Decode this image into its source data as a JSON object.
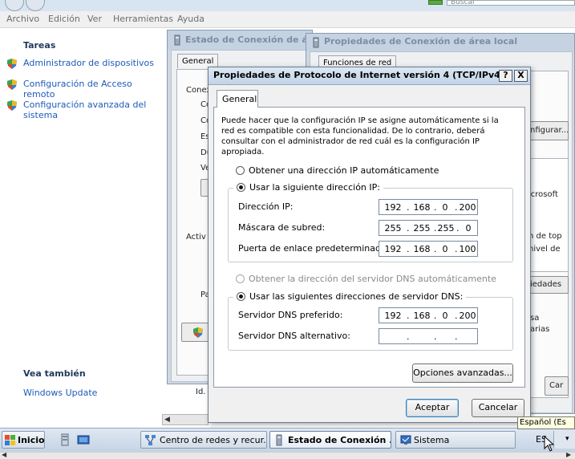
{
  "top": {
    "search_placeholder": "Buscar"
  },
  "menubar": {
    "items": [
      "Archivo",
      "Edición",
      "Ver",
      "Herramientas",
      "Ayuda"
    ]
  },
  "sidebar": {
    "tasks_heading": "Tareas",
    "tasks": [
      "Administrador de dispositivos",
      "Configuración de Acceso remoto",
      "Configuración avanzada del sistema"
    ],
    "see_also_heading": "Vea también",
    "see_also_link": "Windows Update"
  },
  "back_window_1": {
    "title": "Estado de Conexión de área local",
    "tab": "General",
    "fragments": [
      "Conex",
      "Co",
      "Co",
      "Est",
      "Du",
      "Vel",
      "Activ",
      "Pa"
    ],
    "bottom_fragment": "Id."
  },
  "back_window_2": {
    "title": "Propiedades de Conexión de área local",
    "tab": "Funciones de red",
    "fragments": [
      "nfigurar...",
      "icrosoft",
      "n de top",
      "nivel de",
      "iedades",
      "sa",
      "arias"
    ],
    "button_fragment": "Car"
  },
  "dialog": {
    "title": "Propiedades de Protocolo de Internet versión 4 (TCP/IPv4)",
    "help_button": "?",
    "close_button": "X",
    "tab": "General",
    "description": "Puede hacer que la configuración IP se asigne automáticamente si la red es compatible con esta funcionalidad. De lo contrario, deberá consultar con el administrador de red cuál es la configuración IP apropiada.",
    "radio_auto_ip": "Obtener una dirección IP automáticamente",
    "radio_manual_ip": "Usar la siguiente dirección IP:",
    "ip_label": "Dirección IP:",
    "ip_value": [
      "192",
      "168",
      "0",
      "200"
    ],
    "mask_label": "Máscara de subred:",
    "mask_value": [
      "255",
      "255",
      "255",
      "0"
    ],
    "gateway_label": "Puerta de enlace predeterminada:",
    "gateway_value": [
      "192",
      "168",
      "0",
      "100"
    ],
    "radio_auto_dns": "Obtener la dirección del servidor DNS automáticamente",
    "radio_manual_dns": "Usar las siguientes direcciones de servidor DNS:",
    "dns_pref_label": "Servidor DNS preferido:",
    "dns_pref_value": [
      "192",
      "168",
      "0",
      "200"
    ],
    "dns_alt_label": "Servidor DNS alternativo:",
    "dns_alt_value": [
      "",
      "",
      "",
      ""
    ],
    "advanced_button": "Opciones avanzadas...",
    "ok_button": "Aceptar",
    "cancel_button": "Cancelar"
  },
  "taskbar": {
    "start": "Inicio",
    "tasks": [
      "Centro de redes y recur...",
      "Estado de Conexión ...",
      "Sistema"
    ],
    "language": "ES",
    "tooltip": "Español (Es"
  },
  "colors": {
    "link": "#1e5bb8",
    "heading": "#1e395b",
    "default_button": "#3c7fb1"
  }
}
